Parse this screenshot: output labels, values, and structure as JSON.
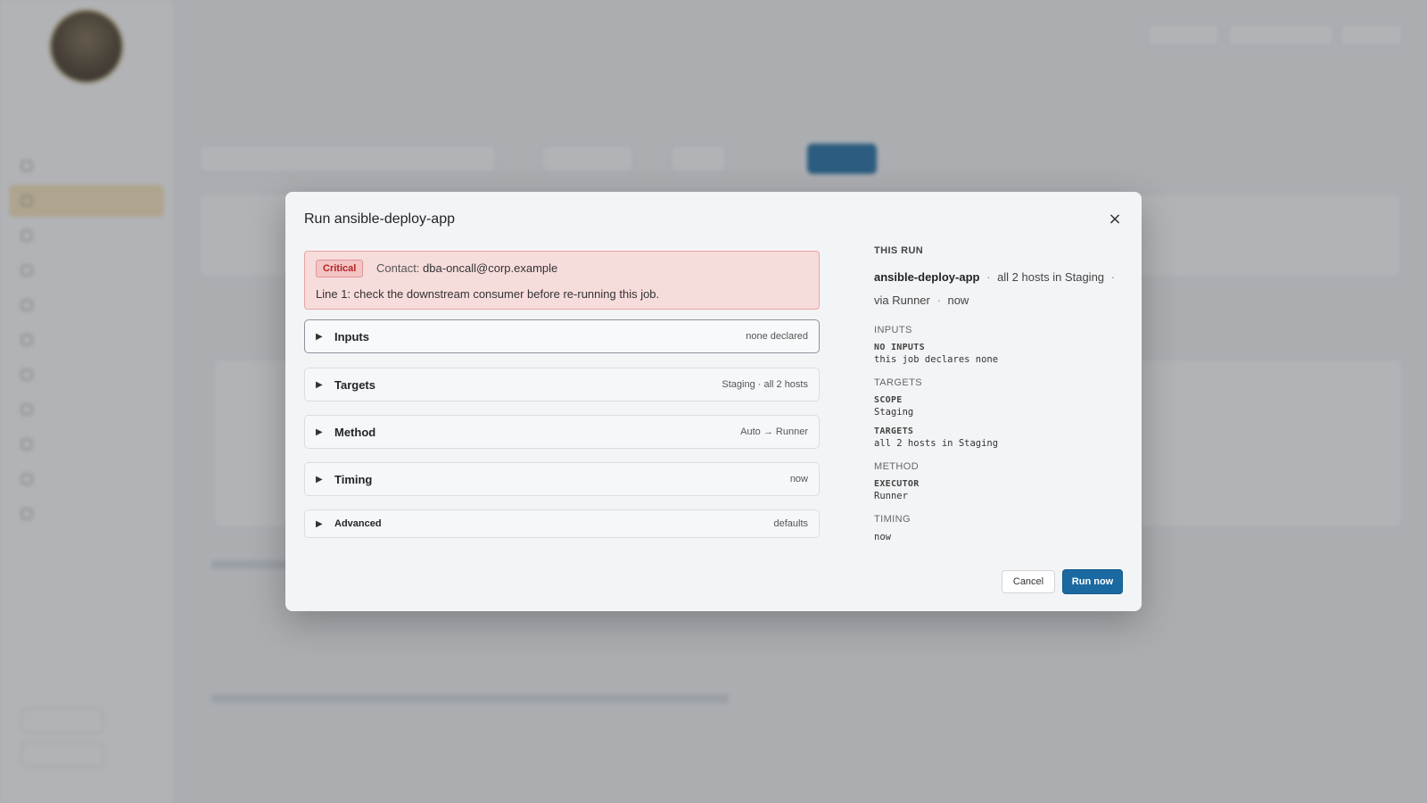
{
  "modal": {
    "title": "Run ansible-deploy-app",
    "close_symbol": "×",
    "alert": {
      "badge": "Critical",
      "contact_label": "Contact:",
      "contact_value": "dba-oncall@corp.example",
      "line": "Line 1: check the downstream consumer before re-running this job."
    },
    "sections": [
      {
        "label": "Inputs",
        "value": "none declared"
      },
      {
        "label": "Targets",
        "value": "Staging · all 2 hosts"
      },
      {
        "label": "Method",
        "value": "Auto → Runner"
      },
      {
        "label": "Timing",
        "value": "now"
      },
      {
        "label": "Advanced",
        "value": "defaults"
      }
    ],
    "summary": {
      "heading": "THIS RUN",
      "job_name": "ansible-deploy-app",
      "scope_text": "all 2 hosts in Staging",
      "via_text": "via Runner",
      "when_text": "now",
      "separator": "·",
      "inputs": {
        "section": "INPUTS",
        "key": "NO INPUTS",
        "value": "this job declares none"
      },
      "targets": {
        "section": "TARGETS",
        "scope_key": "SCOPE",
        "scope_value": "Staging",
        "targets_key": "TARGETS",
        "targets_value": "all 2 hosts in Staging"
      },
      "method": {
        "section": "METHOD",
        "key": "EXECUTOR",
        "value": "Runner"
      },
      "timing": {
        "section": "TIMING",
        "value": "now"
      }
    },
    "buttons": {
      "cancel": "Cancel",
      "run": "Run now"
    }
  },
  "icons": {
    "caret": "▶"
  },
  "colors": {
    "primary": "#1a6aa1",
    "critical": "#b42323",
    "alert_bg": "#f7dcdc"
  }
}
